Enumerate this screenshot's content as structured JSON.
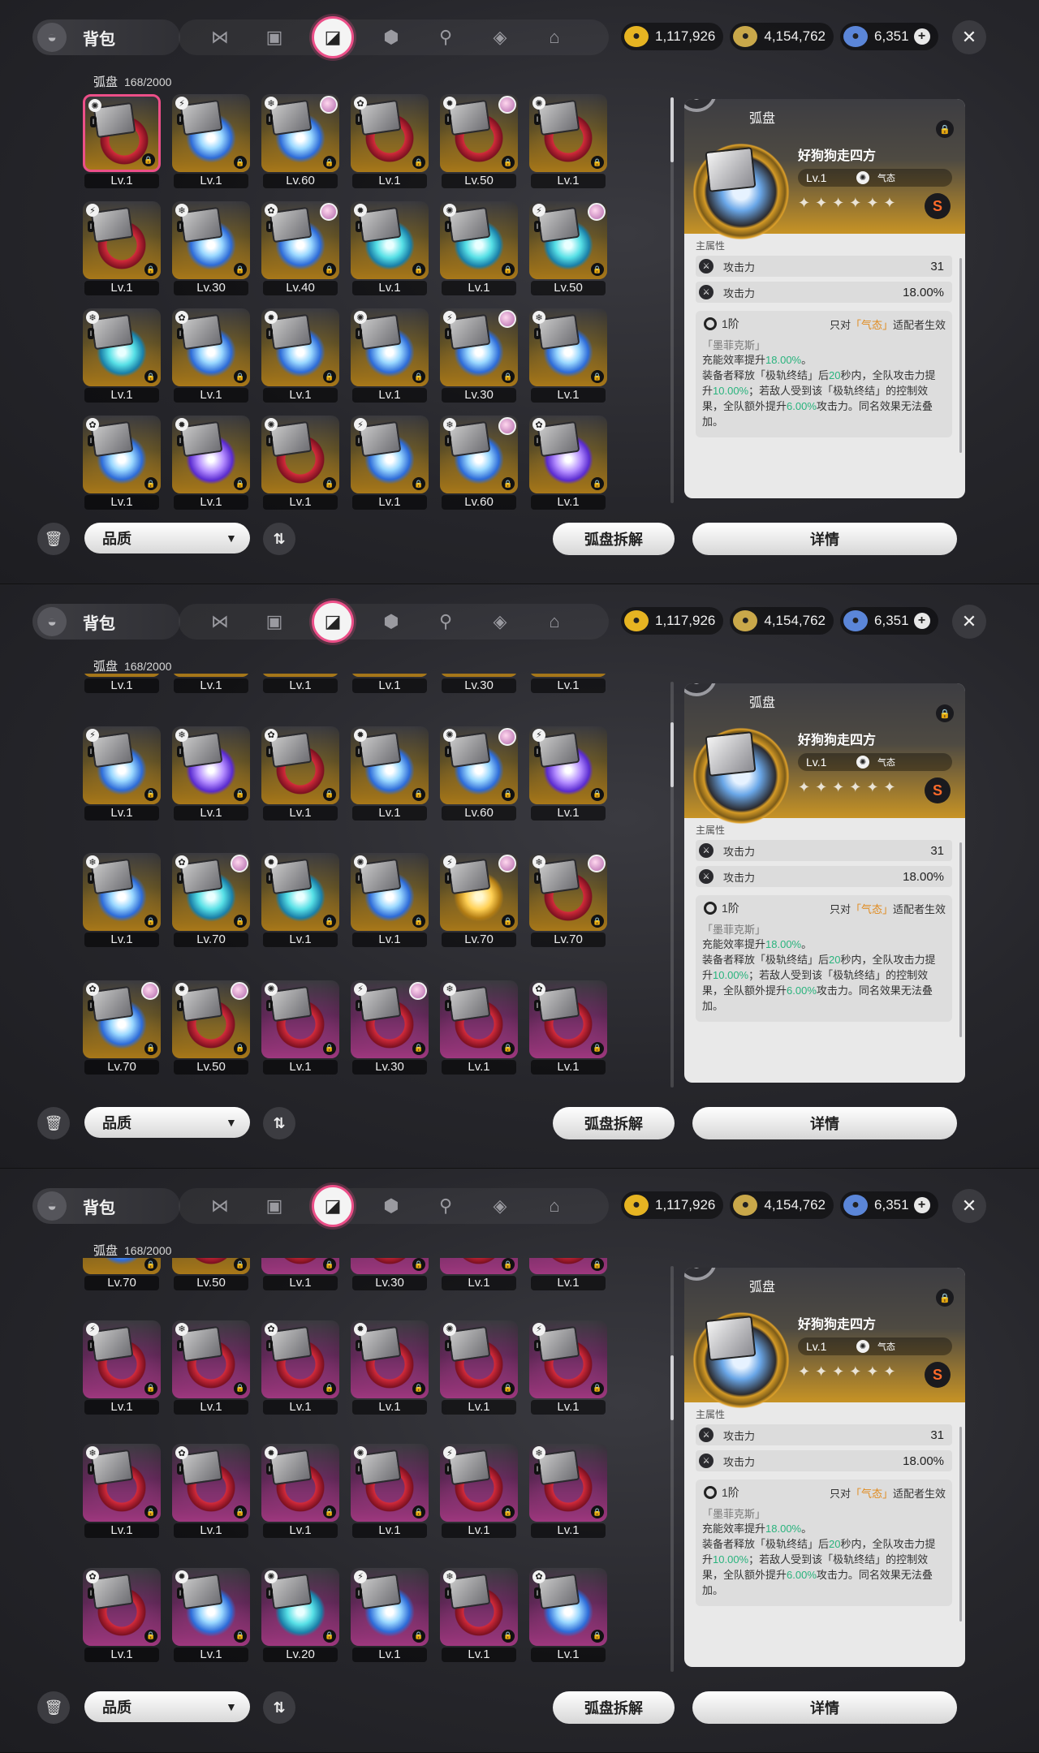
{
  "header": {
    "title": "背包",
    "tabs": [
      {
        "name": "agents",
        "glyph": "⋈"
      },
      {
        "name": "gadgets",
        "glyph": "▣"
      },
      {
        "name": "drive-discs",
        "glyph": "◪"
      },
      {
        "name": "materials",
        "glyph": "⬢"
      },
      {
        "name": "food",
        "glyph": "⚲"
      },
      {
        "name": "w-engines",
        "glyph": "◈"
      },
      {
        "name": "home",
        "glyph": "⌂"
      }
    ],
    "active_tab": 2,
    "currencies": [
      {
        "name": "denny",
        "value": "1,117,926",
        "color": "#e6b422"
      },
      {
        "name": "film",
        "value": "4,154,762",
        "color": "#c9a84a"
      },
      {
        "name": "polychrome",
        "value": "6,351",
        "color": "#5b86d8"
      }
    ]
  },
  "inventory": {
    "label": "弧盘",
    "count": "168/2000"
  },
  "panels": [
    {
      "rows": [
        [
          {
            "level": "Lv.1",
            "rank": "S",
            "ring": "red",
            "selected": true
          },
          {
            "level": "Lv.1",
            "rank": "S",
            "ring": "blue"
          },
          {
            "level": "Lv.60",
            "rank": "S",
            "ring": "blue",
            "avatar": true
          },
          {
            "level": "Lv.1",
            "rank": "S",
            "ring": "red"
          },
          {
            "level": "Lv.50",
            "rank": "S",
            "ring": "red",
            "avatar": true
          },
          {
            "level": "Lv.1",
            "rank": "S",
            "ring": "red"
          }
        ],
        [
          {
            "level": "Lv.1",
            "rank": "S",
            "ring": "red"
          },
          {
            "level": "Lv.30",
            "rank": "S",
            "ring": "blue"
          },
          {
            "level": "Lv.40",
            "rank": "S",
            "ring": "blue",
            "avatar": true
          },
          {
            "level": "Lv.1",
            "rank": "S",
            "ring": "cyan"
          },
          {
            "level": "Lv.1",
            "rank": "S",
            "ring": "cyan"
          },
          {
            "level": "Lv.50",
            "rank": "S",
            "ring": "cyan",
            "avatar": true
          }
        ],
        [
          {
            "level": "Lv.1",
            "rank": "S",
            "ring": "cyan"
          },
          {
            "level": "Lv.1",
            "rank": "S",
            "ring": "blue"
          },
          {
            "level": "Lv.1",
            "rank": "S",
            "ring": "blue"
          },
          {
            "level": "Lv.1",
            "rank": "S",
            "ring": "blue"
          },
          {
            "level": "Lv.30",
            "rank": "S",
            "ring": "blue",
            "avatar": true
          },
          {
            "level": "Lv.1",
            "rank": "S",
            "ring": "blue"
          }
        ],
        [
          {
            "level": "Lv.1",
            "rank": "S",
            "ring": "blue"
          },
          {
            "level": "Lv.1",
            "rank": "S",
            "ring": "violet"
          },
          {
            "level": "Lv.1",
            "rank": "S",
            "ring": "red"
          },
          {
            "level": "Lv.1",
            "rank": "S",
            "ring": "blue"
          },
          {
            "level": "Lv.60",
            "rank": "S",
            "ring": "blue",
            "avatar": true
          },
          {
            "level": "Lv.1",
            "rank": "S",
            "ring": "violet"
          }
        ]
      ]
    },
    {
      "rows": [
        [
          {
            "level": "Lv.1",
            "rank": "S",
            "ring": "blue"
          },
          {
            "level": "Lv.1",
            "rank": "S",
            "ring": "blue"
          },
          {
            "level": "Lv.1",
            "rank": "S",
            "ring": "blue"
          },
          {
            "level": "Lv.1",
            "rank": "S",
            "ring": "blue"
          },
          {
            "level": "Lv.30",
            "rank": "S",
            "ring": "blue"
          },
          {
            "level": "Lv.1",
            "rank": "S",
            "ring": "blue"
          }
        ],
        [
          {
            "level": "Lv.1",
            "rank": "S",
            "ring": "blue"
          },
          {
            "level": "Lv.1",
            "rank": "S",
            "ring": "violet"
          },
          {
            "level": "Lv.1",
            "rank": "S",
            "ring": "red"
          },
          {
            "level": "Lv.1",
            "rank": "S",
            "ring": "blue"
          },
          {
            "level": "Lv.60",
            "rank": "S",
            "ring": "blue",
            "avatar": true
          },
          {
            "level": "Lv.1",
            "rank": "S",
            "ring": "violet"
          }
        ],
        [
          {
            "level": "Lv.1",
            "rank": "S",
            "ring": "blue"
          },
          {
            "level": "Lv.70",
            "rank": "S",
            "ring": "cyan",
            "avatar": true
          },
          {
            "level": "Lv.1",
            "rank": "S",
            "ring": "cyan"
          },
          {
            "level": "Lv.1",
            "rank": "S",
            "ring": "blue"
          },
          {
            "level": "Lv.70",
            "rank": "S",
            "ring": "gold",
            "avatar": true
          },
          {
            "level": "Lv.70",
            "rank": "S",
            "ring": "red",
            "avatar": true
          }
        ],
        [
          {
            "level": "Lv.70",
            "rank": "S",
            "ring": "blue",
            "avatar": true
          },
          {
            "level": "Lv.50",
            "rank": "S",
            "ring": "red",
            "avatar": true
          },
          {
            "level": "Lv.1",
            "rank": "A",
            "ring": "red"
          },
          {
            "level": "Lv.30",
            "rank": "A",
            "ring": "red",
            "avatar": true
          },
          {
            "level": "Lv.1",
            "rank": "A",
            "ring": "red"
          },
          {
            "level": "Lv.1",
            "rank": "A",
            "ring": "red"
          }
        ]
      ]
    },
    {
      "rows": [
        [
          {
            "level": "Lv.70",
            "rank": "S",
            "ring": "blue",
            "avatar": true
          },
          {
            "level": "Lv.50",
            "rank": "S",
            "ring": "red",
            "avatar": true
          },
          {
            "level": "Lv.1",
            "rank": "A",
            "ring": "red"
          },
          {
            "level": "Lv.30",
            "rank": "A",
            "ring": "red",
            "avatar": true
          },
          {
            "level": "Lv.1",
            "rank": "A",
            "ring": "red"
          },
          {
            "level": "Lv.1",
            "rank": "A",
            "ring": "red"
          }
        ],
        [
          {
            "level": "Lv.1",
            "rank": "A",
            "ring": "red"
          },
          {
            "level": "Lv.1",
            "rank": "A",
            "ring": "red"
          },
          {
            "level": "Lv.1",
            "rank": "A",
            "ring": "red"
          },
          {
            "level": "Lv.1",
            "rank": "A",
            "ring": "red"
          },
          {
            "level": "Lv.1",
            "rank": "A",
            "ring": "red"
          },
          {
            "level": "Lv.1",
            "rank": "A",
            "ring": "red"
          }
        ],
        [
          {
            "level": "Lv.1",
            "rank": "A",
            "ring": "red"
          },
          {
            "level": "Lv.1",
            "rank": "A",
            "ring": "red"
          },
          {
            "level": "Lv.1",
            "rank": "A",
            "ring": "red"
          },
          {
            "level": "Lv.1",
            "rank": "A",
            "ring": "red"
          },
          {
            "level": "Lv.1",
            "rank": "A",
            "ring": "red"
          },
          {
            "level": "Lv.1",
            "rank": "A",
            "ring": "red"
          }
        ],
        [
          {
            "level": "Lv.1",
            "rank": "A",
            "ring": "red"
          },
          {
            "level": "Lv.1",
            "rank": "A",
            "ring": "blue"
          },
          {
            "level": "Lv.20",
            "rank": "A",
            "ring": "cyan"
          },
          {
            "level": "Lv.1",
            "rank": "A",
            "ring": "blue"
          },
          {
            "level": "Lv.1",
            "rank": "A",
            "ring": "red"
          },
          {
            "level": "Lv.1",
            "rank": "A",
            "ring": "blue"
          }
        ]
      ]
    }
  ],
  "detail": {
    "header": "弧盘",
    "name": "好狗狗走四方",
    "level": "Lv.1",
    "attribute": "气态",
    "stars": "✦✦✦✦✦✦",
    "rank": "S",
    "main_stat_label": "主属性",
    "stats": [
      {
        "name": "攻击力",
        "value": "31"
      },
      {
        "name": "攻击力",
        "value": "18.00%"
      }
    ],
    "set_tier": "1阶",
    "set_note_prefix": "只对",
    "set_note_attr": "「气态」",
    "set_note_suffix": "适配者生效",
    "set_name": "「墨菲克斯」",
    "desc_line1_a": "充能效率提升",
    "desc_line1_b": "18.00%",
    "desc_line1_c": "。",
    "desc_line2_a": "装备者释放「极轨终结」后",
    "desc_line2_b": "20",
    "desc_line2_c": "秒内，全队攻击力提升",
    "desc_line2_d": "10.00%",
    "desc_line2_e": "；若敌人受到该「极轨终结」的控制效果，全队额外提升",
    "desc_line2_f": "6.00%",
    "desc_line2_g": "攻击力。同名效果无法叠加。"
  },
  "bottom": {
    "quality_label": "品质",
    "dismantle_label": "弧盘拆解",
    "detail_label": "详情"
  },
  "colors": {
    "accent": "#ec4f88",
    "rank_s": "#e0a022",
    "rank_a": "#d24aa8",
    "highlight_green": "#29b37d",
    "highlight_orange": "#e08a1c"
  }
}
